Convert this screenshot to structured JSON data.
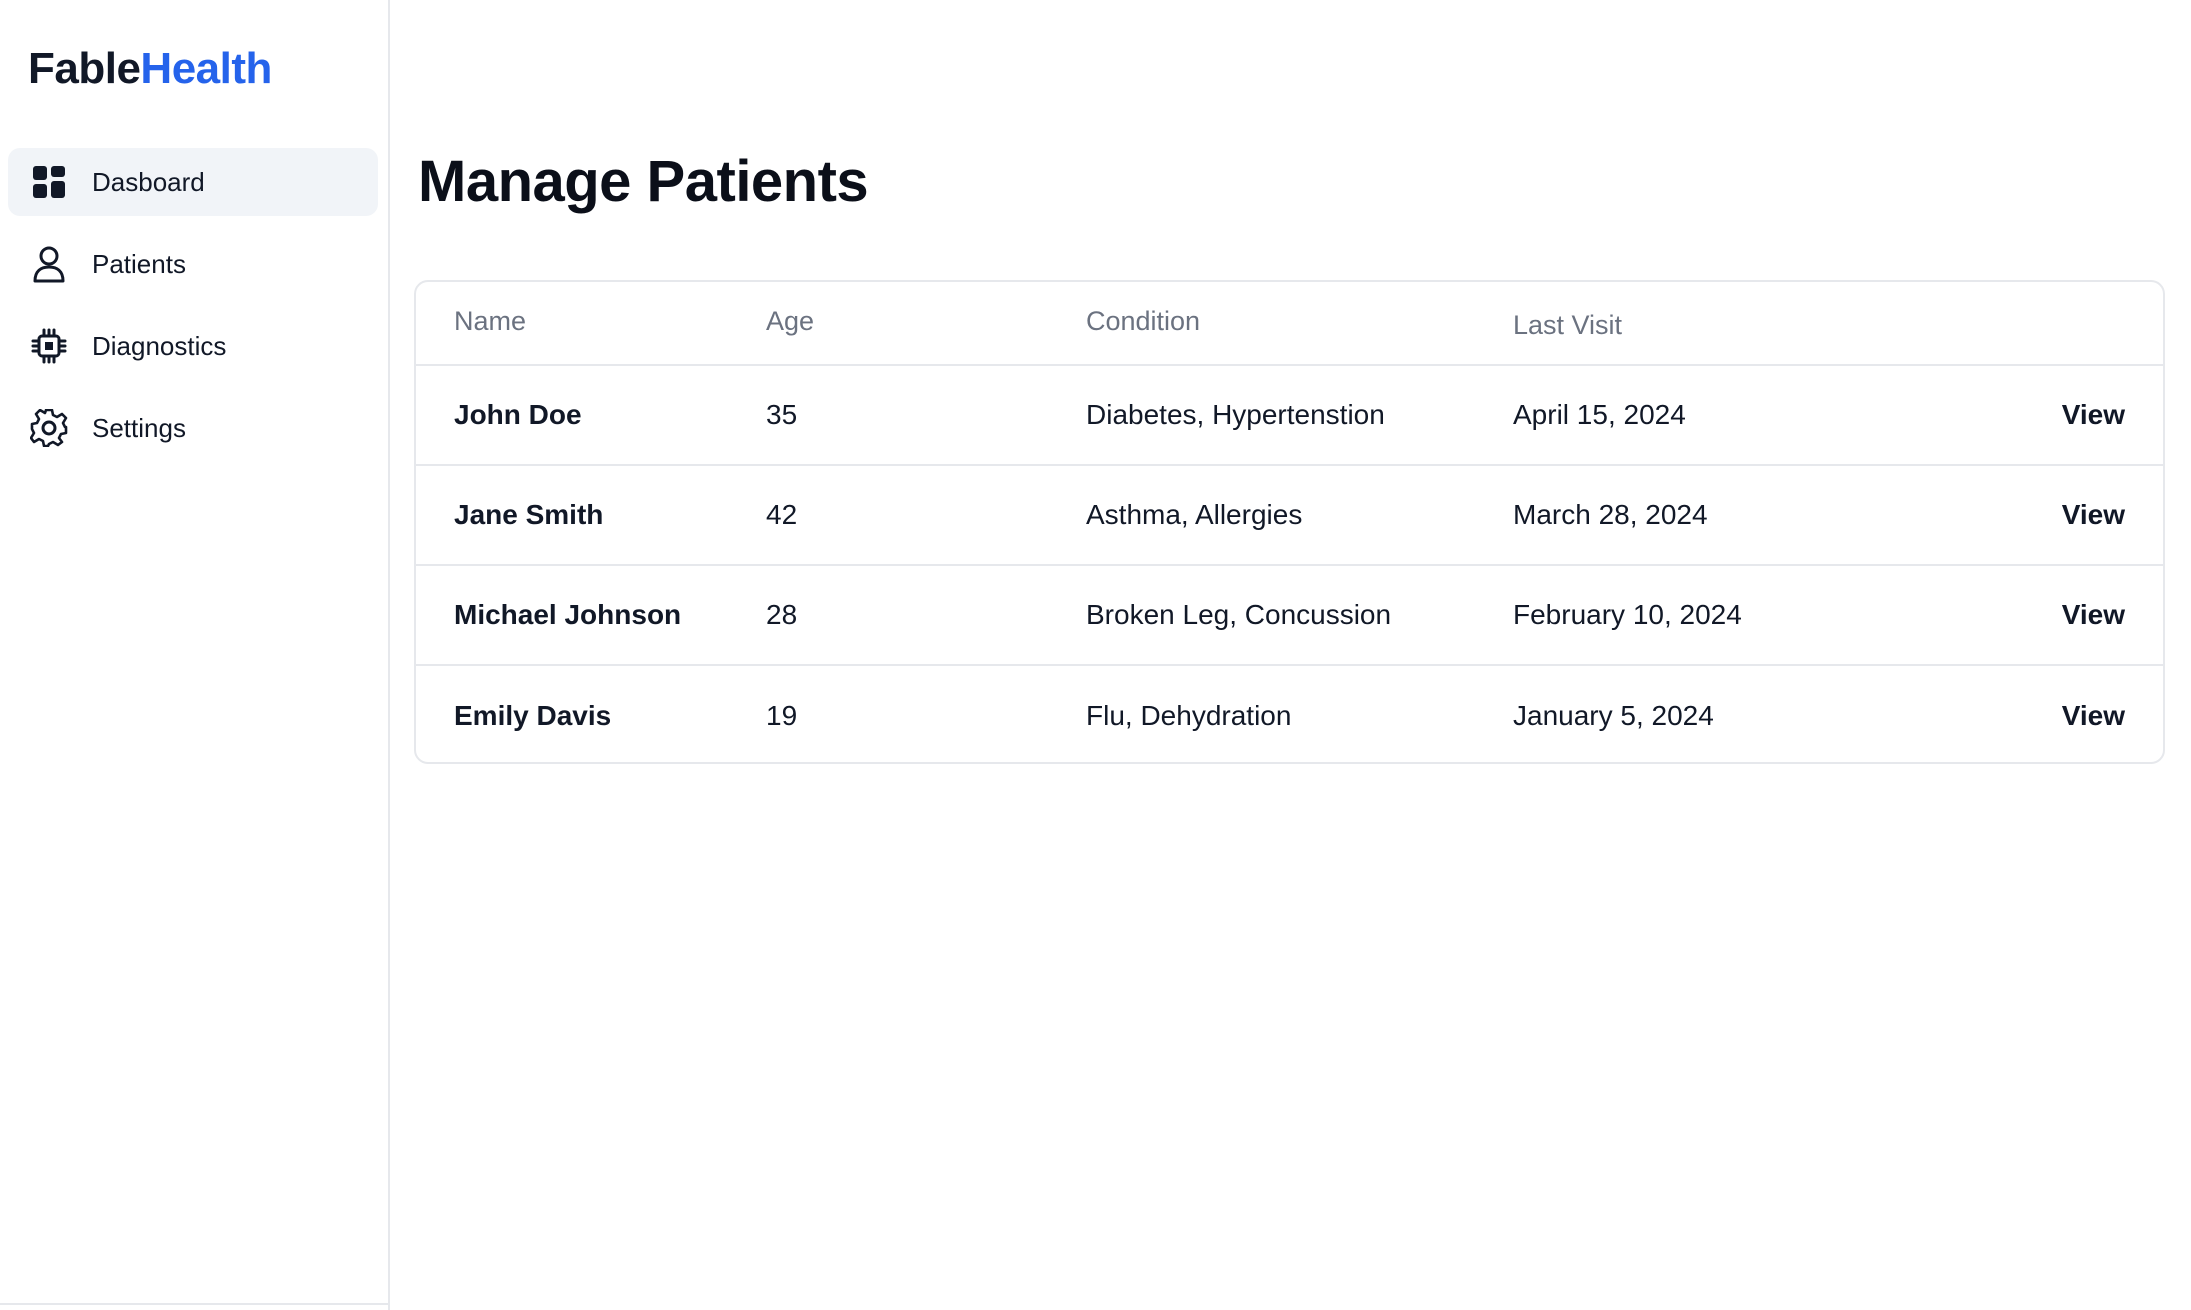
{
  "brand": {
    "part1": "Fable",
    "part2": "Health"
  },
  "sidebar": {
    "items": [
      {
        "label": "Dasboard",
        "icon": "dashboard-grid-icon",
        "active": true
      },
      {
        "label": "Patients",
        "icon": "user-icon",
        "active": false
      },
      {
        "label": "Diagnostics",
        "icon": "chip-icon",
        "active": false
      },
      {
        "label": "Settings",
        "icon": "gear-icon",
        "active": false
      }
    ]
  },
  "main": {
    "title": "Manage Patients",
    "table": {
      "headers": [
        "Name",
        "Age",
        "Condition",
        "Last Visit"
      ],
      "action_label": "View",
      "rows": [
        {
          "name": "John Doe",
          "age": "35",
          "condition": "Diabetes, Hypertenstion",
          "last_visit": "April 15, 2024"
        },
        {
          "name": "Jane Smith",
          "age": "42",
          "condition": "Asthma, Allergies",
          "last_visit": "March 28, 2024"
        },
        {
          "name": "Michael Johnson",
          "age": "28",
          "condition": "Broken Leg, Concussion",
          "last_visit": "February 10, 2024"
        },
        {
          "name": "Emily Davis",
          "age": "19",
          "condition": "Flu, Dehydration",
          "last_visit": "January 5, 2024"
        }
      ]
    }
  },
  "colors": {
    "brand_dark": "#111827",
    "brand_accent": "#2563eb",
    "active_nav_bg": "#f1f4f8",
    "border": "#e6e8ec",
    "header_text": "#6b7280"
  }
}
